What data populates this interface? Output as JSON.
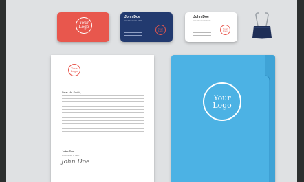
{
  "logo": {
    "line1": "Your",
    "line2": "Logo"
  },
  "navy_card": {
    "name": "John Doe",
    "title": "Art Director & CEO"
  },
  "white_card": {
    "name": "John Doe",
    "title": "Art Director & CEO"
  },
  "letter": {
    "greeting": "Dear Mr. Smith,",
    "signer_name": "John Doe",
    "signer_title": "Art Director & CEO",
    "signature": "John Doe"
  },
  "colors": {
    "background": "#dfe1e3",
    "coral": "#e8574d",
    "navy": "#223a6f",
    "folder_blue": "#4cb2e4",
    "frame": "#2c2f2f"
  },
  "icons": {
    "clip": "binder-clip-icon"
  }
}
